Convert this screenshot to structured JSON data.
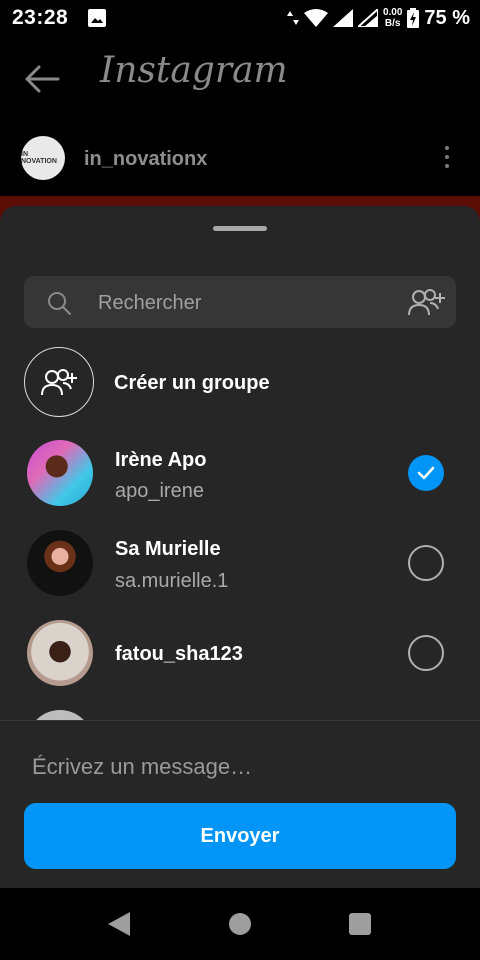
{
  "status_bar": {
    "time": "23:28",
    "speed_value": "0.00",
    "speed_unit": "B/s",
    "battery": "75 %"
  },
  "header": {
    "app_name": "Instagram"
  },
  "profile": {
    "username": "in_novationx",
    "avatar_text": "IN NOVATION"
  },
  "share_sheet": {
    "search_placeholder": "Rechercher",
    "create_group_label": "Créer un groupe",
    "contacts": [
      {
        "name": "Irène Apo",
        "handle": "apo_irene",
        "selected": true
      },
      {
        "name": "Sa Murielle",
        "handle": "sa.murielle.1",
        "selected": false
      },
      {
        "name": "fatou_sha123",
        "handle": "",
        "selected": false
      }
    ],
    "message_placeholder": "Écrivez un message…",
    "send_label": "Envoyer"
  },
  "colors": {
    "accent": "#0095f6",
    "sheet_bg": "#262626",
    "search_bg": "#363636"
  }
}
